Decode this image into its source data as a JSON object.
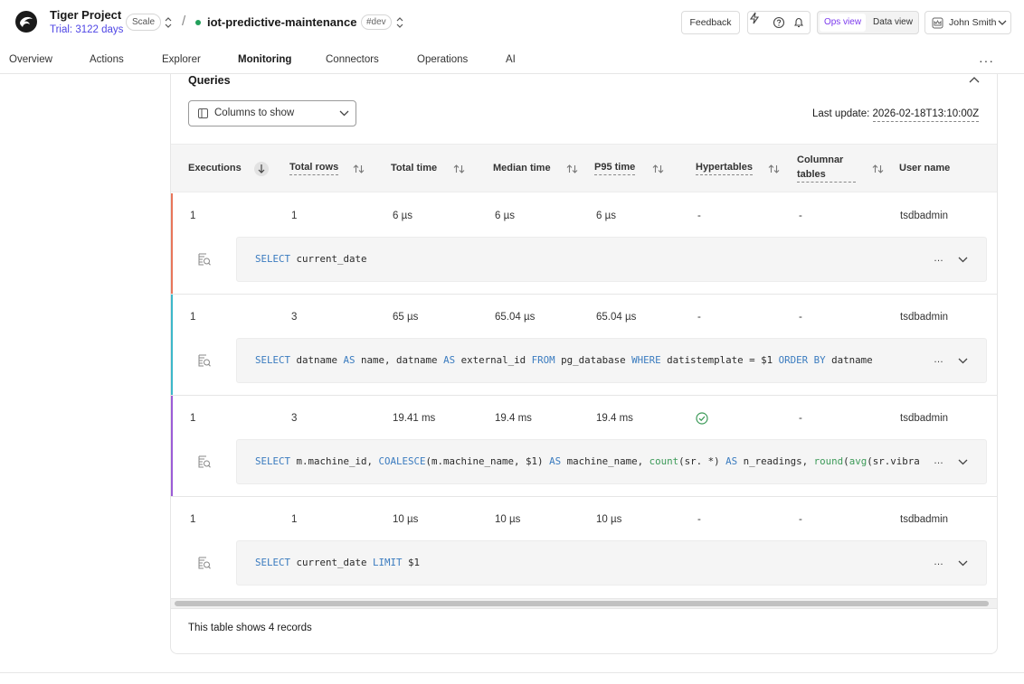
{
  "header": {
    "project_name": "Tiger Project",
    "trial": "Trial: 3122 days",
    "plan_badge": "Scale",
    "separator": "/",
    "service_name": "iot-predictive-maintenance",
    "env_badge": "#dev",
    "feedback_label": "Feedback",
    "ops_view_label": "Ops view",
    "data_view_label": "Data view",
    "user_name": "John Smith",
    "icons": [
      "bolt-icon",
      "help-icon",
      "bell-icon"
    ]
  },
  "tabs": [
    {
      "label": "Overview"
    },
    {
      "label": "Actions"
    },
    {
      "label": "Explorer"
    },
    {
      "label": "Monitoring"
    },
    {
      "label": "Connectors"
    },
    {
      "label": "Operations"
    },
    {
      "label": "AI"
    }
  ],
  "more_label": "···",
  "queries": {
    "title": "Queries",
    "columns_button": "Columns to show",
    "last_update_label": "Last update:",
    "last_update_value": "2026-02-18T13:10:00Z",
    "columns": [
      "Executions",
      "Total rows",
      "Total time",
      "Median time",
      "P95 time",
      "Hypertables",
      "Columnar",
      "tables",
      "User name"
    ],
    "rows": [
      {
        "executions": "1",
        "total_rows": "1",
        "total_time": "6 µs",
        "median_time": "6 µs",
        "p95_time": "6 µs",
        "hypertables": "-",
        "columnar": "-",
        "user": "tsdbadmin",
        "accent": "#e8755a"
      },
      {
        "executions": "1",
        "total_rows": "3",
        "total_time": "65 µs",
        "median_time": "65.04 µs",
        "p95_time": "65.04 µs",
        "hypertables": "-",
        "columnar": "-",
        "user": "tsdbadmin",
        "accent": "#3cb7c9"
      },
      {
        "executions": "1",
        "total_rows": "3",
        "total_time": "19.41 ms",
        "median_time": "19.4 ms",
        "p95_time": "19.4 ms",
        "hypertables": "",
        "columnar": "-",
        "user": "tsdbadmin",
        "accent": "#9b5cd6"
      },
      {
        "executions": "1",
        "total_rows": "1",
        "total_time": "10 µs",
        "median_time": "10 µs",
        "p95_time": "10 µs",
        "hypertables": "-",
        "columnar": "-",
        "user": "tsdbadmin",
        "accent": "#ffffff"
      }
    ],
    "sql": {
      "r0": {
        "kw1": "SELECT",
        "rest": " current_date"
      },
      "r1": {
        "kw1": "SELECT",
        "t1": " datname ",
        "kw2": "AS",
        "t2": " name, datname ",
        "kw3": "AS",
        "t3": " external_id ",
        "kw4": "FROM",
        "t4": " pg_database ",
        "kw5": "WHERE",
        "t5": " datistemplate = $1 ",
        "kw6": "ORDER BY",
        "t6": " datname"
      },
      "r2": {
        "kw1": "SELECT",
        "t1": " m.machine_id, ",
        "fn1": "COALESCE",
        "t2": "(m.machine_name, $1) ",
        "kw2": "AS",
        "t3": " machine_name, ",
        "fn2": "count",
        "t4": "(sr. *) ",
        "kw3": "AS",
        "t5": " n_readings, ",
        "fn3": "round",
        "t6": "(",
        "fn4": "avg",
        "t7": "(sr.vibra"
      },
      "r3": {
        "kw1": "SELECT",
        "t1": " current_date ",
        "kw2": "LIMIT",
        "t2": " $1"
      }
    },
    "ellipsis": "…",
    "footer": "This table shows 4 records"
  }
}
